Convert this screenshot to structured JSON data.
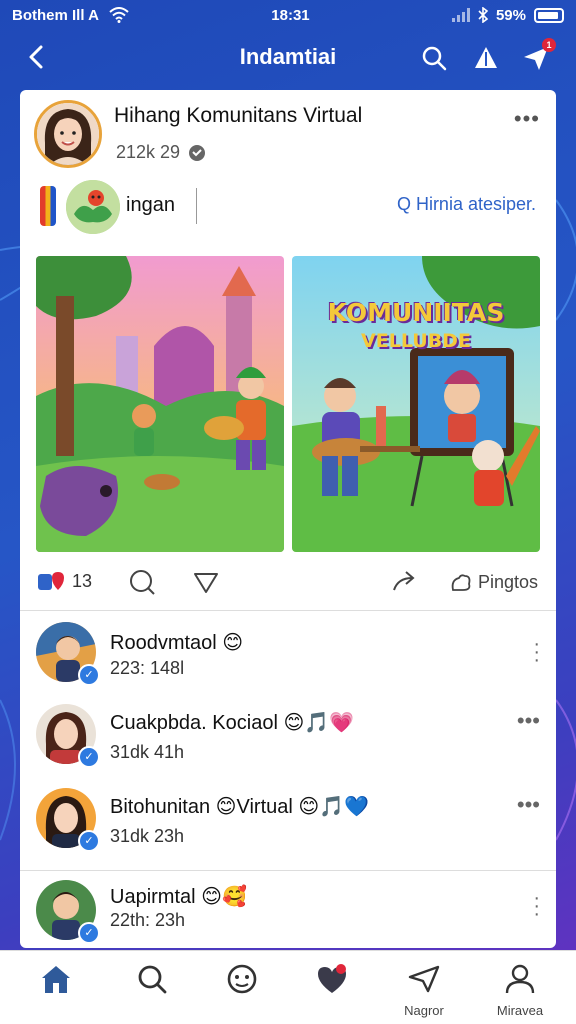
{
  "status_bar": {
    "carrier": "Bothem Ill A",
    "time": "18:31",
    "battery": "59%"
  },
  "header": {
    "title": "Indamtiai",
    "notification_count": "1",
    "icons": [
      "back-arrow-icon",
      "search-icon",
      "alert-icon",
      "send-icon"
    ]
  },
  "post": {
    "title": "Hihang Komunitans Virtual",
    "meta": "212k 29",
    "story_label": "ingan",
    "story_search": "Q Hirnia atesiper.",
    "image_right_title_1": "KOMUNIITAS",
    "image_right_title_2": "VELLUBDE",
    "reaction_count": "13",
    "share_label": "Pingtos"
  },
  "comments": [
    {
      "name": "Roodvmtaol",
      "emoji": "😊",
      "meta": "223: 148l"
    },
    {
      "name": "Cuakpbda. Kociaol",
      "emoji": "😊🎵💗",
      "meta": "31dk 41h"
    },
    {
      "name": "Bitohunitan",
      "emoji_mid": "😊",
      "name2": "Virtual",
      "emoji": "😊🎵💙",
      "meta": "31dk 23h"
    },
    {
      "name": "Uapirmtal",
      "emoji": "😊🥰",
      "meta": "22th: 23h"
    }
  ],
  "bottom_nav": [
    {
      "label": "",
      "icon": "home-icon"
    },
    {
      "label": "",
      "icon": "search-icon"
    },
    {
      "label": "",
      "icon": "community-icon"
    },
    {
      "label": "",
      "icon": "heart-icon"
    },
    {
      "label": "Nagror",
      "icon": "send-icon"
    },
    {
      "label": "Miravea",
      "icon": "profile-icon"
    }
  ],
  "colors": {
    "background": "#2656c6",
    "accent_blue": "#2f63c8",
    "notification_red": "#e0263a"
  }
}
